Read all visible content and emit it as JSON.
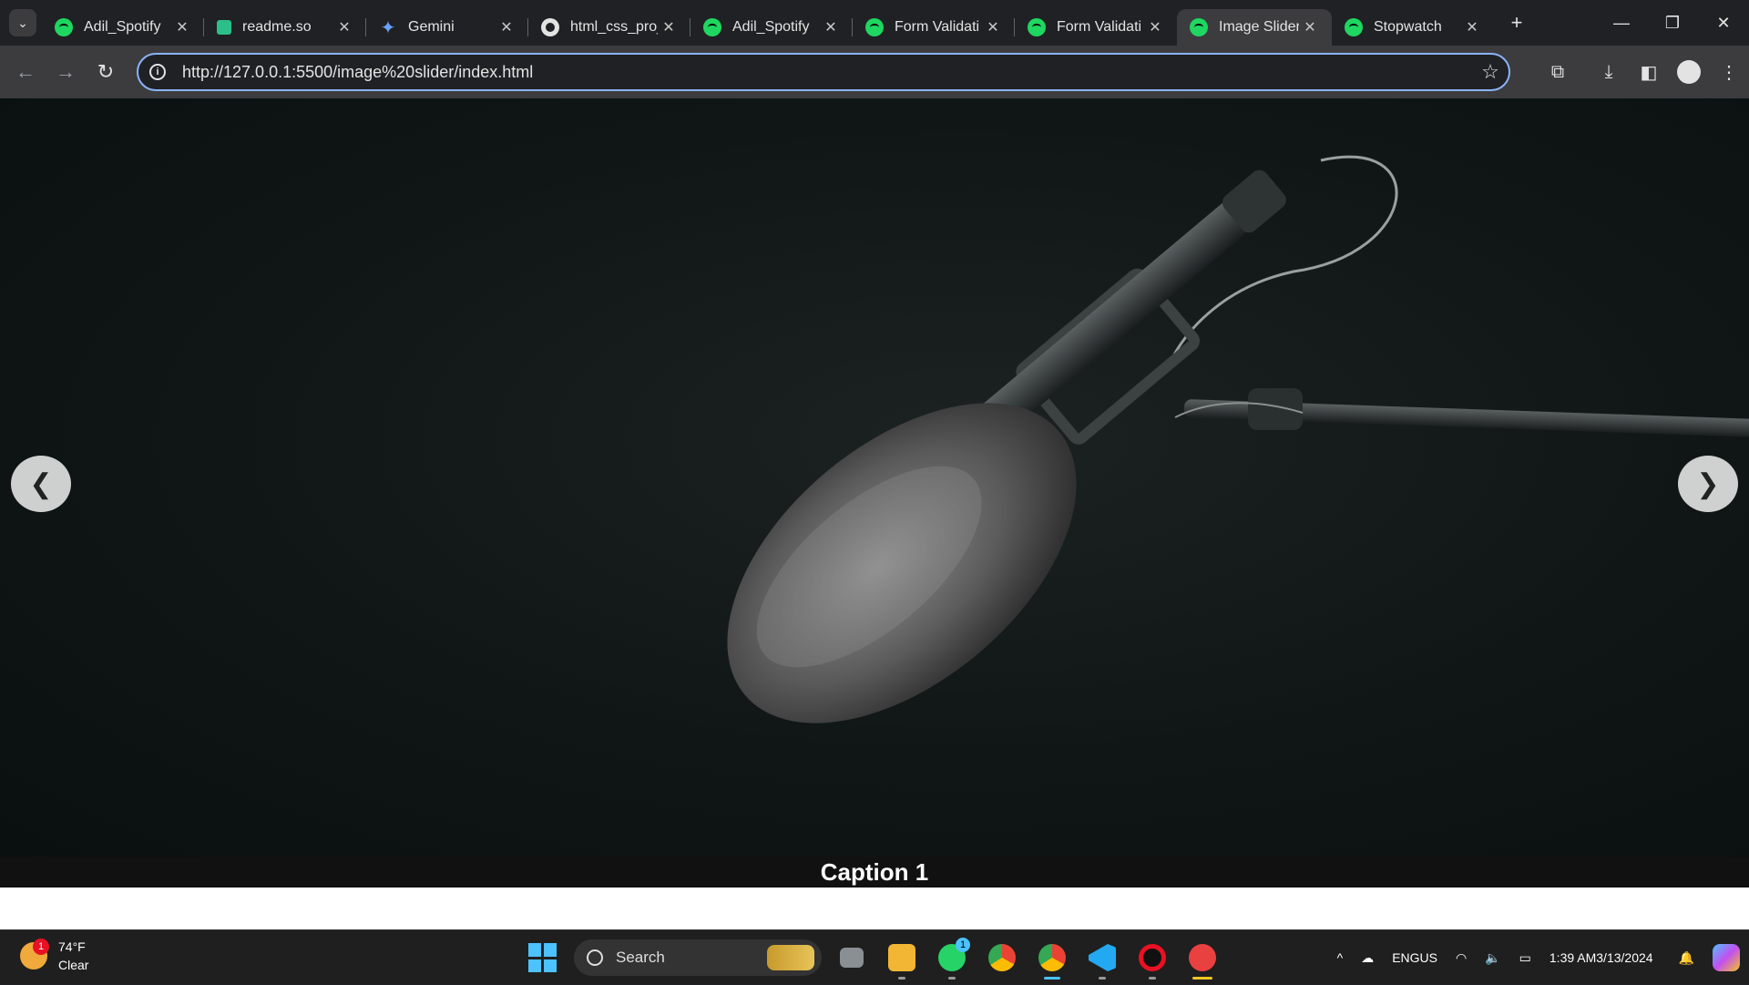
{
  "browser": {
    "tabs": [
      {
        "title": "Adil_Spotify",
        "icon": "spotify-icon",
        "active": false
      },
      {
        "title": "readme.so",
        "icon": "readme-icon",
        "active": false
      },
      {
        "title": "Gemini",
        "icon": "gemini-icon",
        "active": false
      },
      {
        "title": "html_css_proj",
        "icon": "github-icon",
        "active": false
      },
      {
        "title": "Adil_Spotify",
        "icon": "spotify-icon",
        "active": false
      },
      {
        "title": "Form Validati",
        "icon": "spotify-icon",
        "active": false
      },
      {
        "title": "Form Validati",
        "icon": "spotify-icon",
        "active": false
      },
      {
        "title": "Image Slider",
        "icon": "spotify-icon",
        "active": true
      },
      {
        "title": "Stopwatch",
        "icon": "spotify-icon",
        "active": false
      }
    ],
    "url": "http://127.0.0.1:5500/image%20slider/index.html"
  },
  "slider": {
    "caption": "Caption 1",
    "prev_label": "❮",
    "next_label": "❯",
    "image_subject": "shotgun microphone with furry windscreen on boom arm"
  },
  "taskbar": {
    "weather_temp": "74°F",
    "weather_desc": "Clear",
    "weather_badge": "1",
    "search_placeholder": "Search",
    "lang_top": "ENG",
    "lang_bottom": "US",
    "time": "1:39 AM",
    "date": "3/13/2024",
    "whatsapp_badge": "1"
  },
  "colors": {
    "accent": "#8ab4f8",
    "spotify": "#1ed760",
    "chrome_dark": "#202124",
    "toolbar": "#3c3c3f"
  }
}
